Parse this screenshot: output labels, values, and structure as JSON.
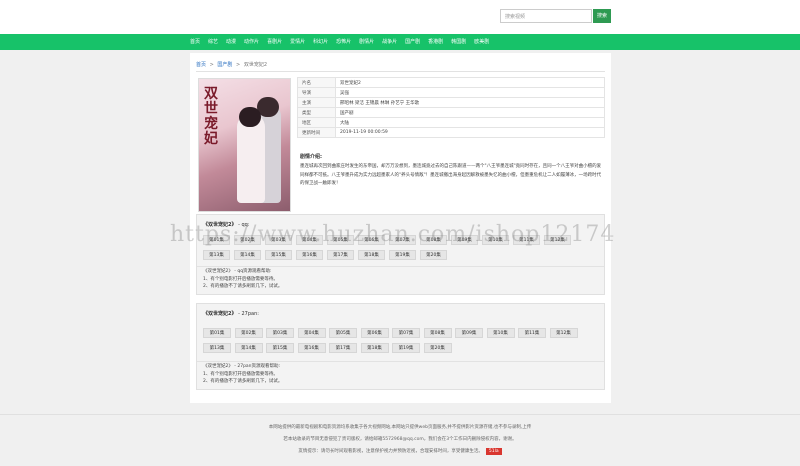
{
  "search": {
    "placeholder": "搜索视频",
    "button": "搜索"
  },
  "nav": [
    "首页",
    "综艺",
    "动漫",
    "动作片",
    "喜剧片",
    "爱情片",
    "科幻片",
    "恐怖片",
    "剧情片",
    "战争片",
    "国产剧",
    "香港剧",
    "韩国剧",
    "欧美剧"
  ],
  "breadcrumb": {
    "home": "首页",
    "category": "国产剧",
    "current": "双世宠妃2"
  },
  "poster": {
    "calligraphy": "双世宠妃",
    "alt": "双世宠妃2 poster"
  },
  "info": [
    {
      "key": "片名",
      "value": "双世宠妃2"
    },
    {
      "key": "导演",
      "value": "吴强"
    },
    {
      "key": "主演",
      "value": "邢昭林 梁洁 王锦晨 林琳 孙艺宁 王华歌"
    },
    {
      "key": "类型",
      "value": "国产剧"
    },
    {
      "key": "地区",
      "value": "大陆"
    },
    {
      "key": "更新时间",
      "value": "2019-11-19 00:00:59"
    }
  ],
  "synopsis": {
    "title": "剧情介绍:",
    "text": "墨连城再次回到曲家庄时发生的东帝国，却万万没想到，墨连城竟过去的自己陈跟道——两个\"八王爷墨连城\"竟同时存在，且同一个八王爷对曲小檀的爱同样都不可抵。八王爷墨升成为实力远超墨家人的\"养头号情敌\"！墨连城撤出海身起因解救被墨失忆的曲小檀，但墨重危机让二人如履薄冰，一场跨时代的保卫战一触即发！"
  },
  "source1": {
    "name": "《双世宠妃2》",
    "suffix": " - qq:",
    "episodes": [
      "第01集",
      "第02集",
      "第03集",
      "第04集",
      "第05集",
      "第06集",
      "第07集",
      "第08集",
      "第09集",
      "第10集",
      "第11集",
      "第12集",
      "第13集",
      "第14集",
      "第15集",
      "第16集",
      "第17集",
      "第18集",
      "第19集",
      "第20集"
    ],
    "help_title": "《双世宠妃2》 - qq资源观看帮助:",
    "help_lines": [
      "1、有个别电影打开后播放需要等待。",
      "2、有的播放不了请多刷新几下，试试。"
    ]
  },
  "source2": {
    "name": "《双世宠妃2》",
    "suffix": " - 27pan:",
    "episodes": [
      "第01集",
      "第02集",
      "第03集",
      "第04集",
      "第05集",
      "第06集",
      "第07集",
      "第08集",
      "第09集",
      "第10集",
      "第11集",
      "第12集",
      "第13集",
      "第14集",
      "第15集",
      "第16集",
      "第17集",
      "第18集",
      "第19集",
      "第20集"
    ],
    "help_title": "《双世宠妃2》 - 27pan资源观看帮助:",
    "help_lines": [
      "1、有个别电影打开后播放需要等待。",
      "2、有的播放不了请多刷新几下，试试。"
    ]
  },
  "watermark": "https://www.huzhan.com/ishop12174",
  "footer": {
    "line1": "本网站提供的最新电视剧和电影资源均系收集于各大视频网站,本网站只提供web页面服务,并不提供影片资源存储,也不参与录制,上传",
    "line2": "若本站收录的节目无意侵犯了贵司版权，请给邮箱5572968@qq.com，我们会在3个工作日内删除侵权内容，谢谢。",
    "line3": "友情提示：请勿长时间观看影视，注意保护视力并预防近视，合理安排时间，享受健康生活。",
    "badge": "51la"
  },
  "colors": {
    "nav_green": "#17c269",
    "search_btn": "#2e9a52",
    "link_blue": "#2a6fc0",
    "badge_red": "#d9362f"
  }
}
